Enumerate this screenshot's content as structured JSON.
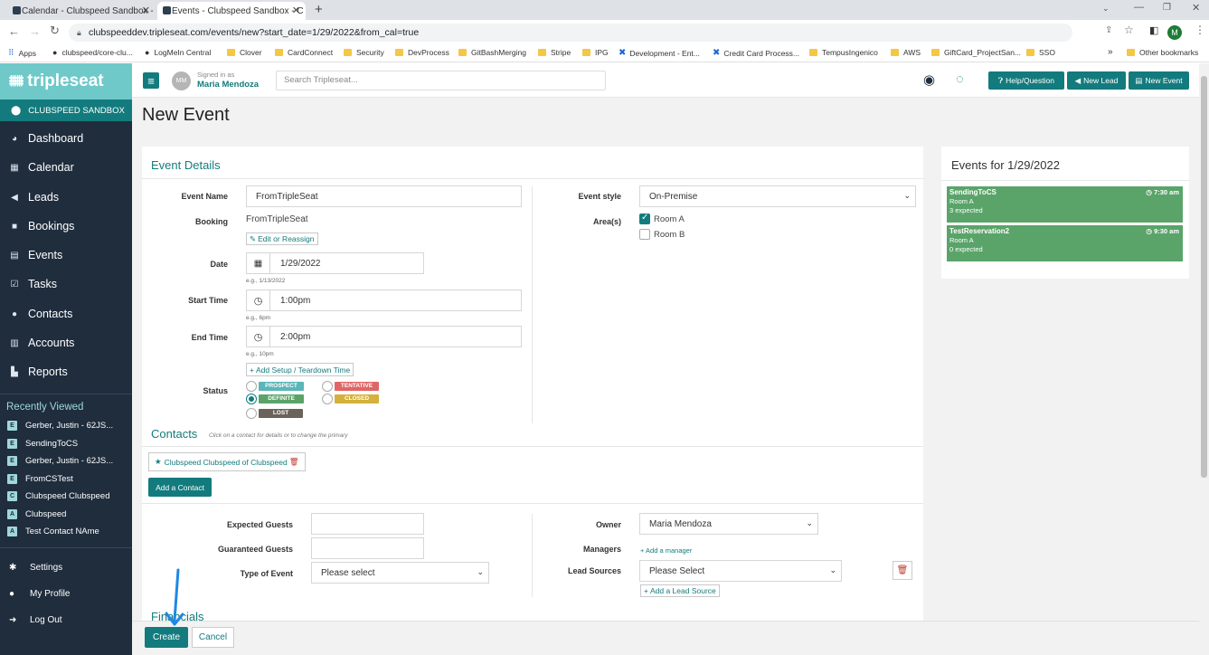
{
  "browser": {
    "tabs": [
      {
        "label": "Calendar - Clubspeed Sandbox -"
      },
      {
        "label": "Events - Clubspeed Sandbox - C"
      }
    ],
    "new_tab": "+",
    "url": "clubspeeddev.tripleseat.com/events/new?start_date=1/29/2022&from_cal=true",
    "bookmarks": [
      "Apps",
      "clubspeed/core-clu...",
      "LogMeIn Central",
      "Clover",
      "CardConnect",
      "Security",
      "DevProcess",
      "GitBashMerging",
      "Stripe",
      "IPG",
      "Development - Ent...",
      "Credit Card Process...",
      "TempusIngenico",
      "AWS",
      "GiftCard_ProjectSan...",
      "SSO"
    ],
    "other_bookmarks": "Other bookmarks",
    "more": "»",
    "profile_initial": "M"
  },
  "sidebar": {
    "logo": "tripleseat",
    "location": "CLUBSPEED SANDBOX",
    "nav": [
      {
        "label": "Dashboard",
        "icon": "dashboard-icon",
        "glyph": "◕"
      },
      {
        "label": "Calendar",
        "icon": "calendar-icon",
        "glyph": "▦"
      },
      {
        "label": "Leads",
        "icon": "megaphone-icon",
        "glyph": "◀"
      },
      {
        "label": "Bookings",
        "icon": "bookmark-icon",
        "glyph": "■"
      },
      {
        "label": "Events",
        "icon": "events-icon",
        "glyph": "▤"
      },
      {
        "label": "Tasks",
        "icon": "check-square-icon",
        "glyph": "☑"
      },
      {
        "label": "Contacts",
        "icon": "users-icon",
        "glyph": "●"
      },
      {
        "label": "Accounts",
        "icon": "building-icon",
        "glyph": "▥"
      },
      {
        "label": "Reports",
        "icon": "chart-icon",
        "glyph": "▙"
      }
    ],
    "recently_viewed_title": "Recently Viewed",
    "recent": [
      {
        "badge": "E",
        "label": "Gerber, Justin - 62JS..."
      },
      {
        "badge": "E",
        "label": "SendingToCS"
      },
      {
        "badge": "E",
        "label": "Gerber, Justin - 62JS..."
      },
      {
        "badge": "E",
        "label": "FromCSTest"
      },
      {
        "badge": "C",
        "label": "Clubspeed Clubspeed"
      },
      {
        "badge": "A",
        "label": "Clubspeed"
      },
      {
        "badge": "A",
        "label": "Test Contact NAme"
      }
    ],
    "bottom": [
      {
        "label": "Settings",
        "icon": "gear-icon",
        "glyph": "✱"
      },
      {
        "label": "My Profile",
        "icon": "user-icon",
        "glyph": "●"
      },
      {
        "label": "Log Out",
        "icon": "logout-icon",
        "glyph": "➜"
      }
    ]
  },
  "topbar": {
    "menu_glyph": "≡",
    "avatar_initials": "MM",
    "signed_in_as": "Signed in as",
    "user_name": "Maria Mendoza",
    "search_placeholder": "Search Tripleseat...",
    "globe_glyph": "◉",
    "chat_glyph": "◌",
    "help_label": "Help/Question",
    "new_lead_label": "New Lead",
    "new_event_label": "New Event"
  },
  "page": {
    "title": "New Event"
  },
  "event_details": {
    "section_title": "Event Details",
    "event_name_label": "Event Name",
    "event_name_value": "FromTripleSeat",
    "booking_label": "Booking",
    "booking_value": "FromTripleSeat",
    "edit_reassign": "Edit or Reassign",
    "date_label": "Date",
    "date_value": "1/29/2022",
    "date_hint": "e.g., 1/13/2022",
    "start_label": "Start Time",
    "start_value": "1:00pm",
    "start_hint": "e.g., 6pm",
    "end_label": "End Time",
    "end_value": "2:00pm",
    "end_hint": "e.g., 10pm",
    "add_setup": "Add Setup / Teardown Time",
    "status_label": "Status",
    "statuses": [
      {
        "label": "PROSPECT",
        "color": "#5bb5b9",
        "selected": false
      },
      {
        "label": "TENTATIVE",
        "color": "#e06666",
        "selected": false
      },
      {
        "label": "DEFINITE",
        "color": "#5aa469",
        "selected": true
      },
      {
        "label": "CLOSED",
        "color": "#d4b13a",
        "selected": false
      },
      {
        "label": "LOST",
        "color": "#6b635a",
        "selected": false
      }
    ],
    "event_style_label": "Event style",
    "event_style_value": "On-Premise",
    "areas_label": "Area(s)",
    "areas": [
      {
        "label": "Room A",
        "checked": true
      },
      {
        "label": "Room B",
        "checked": false
      }
    ]
  },
  "contacts": {
    "title": "Contacts",
    "hint": "Click on a contact for details or to change the primary",
    "contact_name": "Clubspeed Clubspeed of Clubspeed",
    "add_contact": "Add a Contact"
  },
  "guests": {
    "expected_label": "Expected Guests",
    "expected_value": "",
    "guaranteed_label": "Guaranteed Guests",
    "guaranteed_value": "",
    "type_label": "Type of Event",
    "type_value": "Please select",
    "owner_label": "Owner",
    "owner_value": "Maria Mendoza",
    "managers_label": "Managers",
    "add_manager": "+ Add a manager",
    "lead_sources_label": "Lead Sources",
    "lead_sources_value": "Please Select",
    "add_lead_source": "Add a Lead Source"
  },
  "financials": {
    "title": "Financials"
  },
  "footer": {
    "create": "Create",
    "cancel": "Cancel"
  },
  "events_panel": {
    "title": "Events for 1/29/2022",
    "events": [
      {
        "name": "SendingToCS",
        "time": "7:30 am",
        "room": "Room A",
        "expected": "3 expected"
      },
      {
        "name": "TestReservation2",
        "time": "9:30 am",
        "room": "Room A",
        "expected": "0 expected"
      }
    ]
  },
  "colors": {
    "teal": "#137b7d",
    "sidebar": "#1f2d3d",
    "event_green": "#5aa469",
    "annotation_arrow": "#1e88e5"
  }
}
